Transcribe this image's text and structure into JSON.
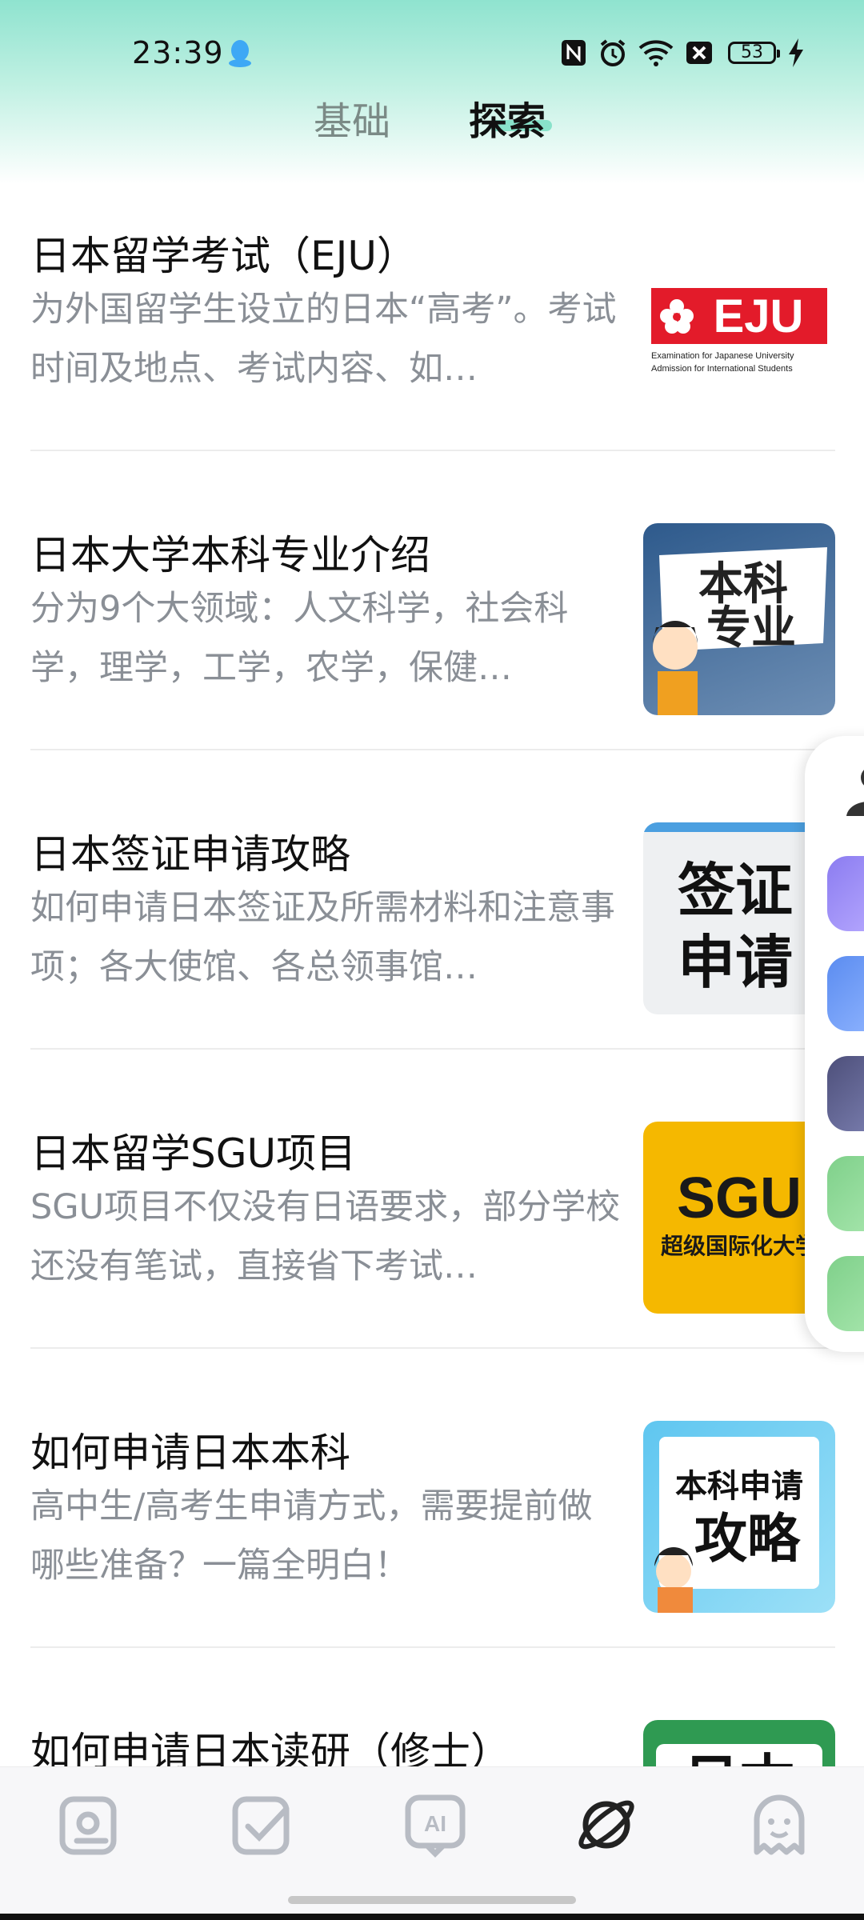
{
  "status_bar": {
    "time": "23:39",
    "battery": "53",
    "icons": [
      "qq-icon",
      "nfc-icon",
      "alarm-icon",
      "wifi-icon",
      "sim-off-icon",
      "battery-icon",
      "charging-icon"
    ]
  },
  "tabs": [
    {
      "label": "基础",
      "active": false
    },
    {
      "label": "探索",
      "active": true
    }
  ],
  "articles": [
    {
      "title": "日本留学考试（EJU）",
      "desc": "为外国留学生设立的日本“高考”。考试时间及地点、考试内容、如…",
      "thumb": {
        "main": "EJU",
        "line1": "Examination for Japanese University",
        "line2": "Admission for International Students"
      }
    },
    {
      "title": "日本大学本科专业介绍",
      "desc": "分为9个大领域：人文科学，社会科学，理学，工学，农学，保健…",
      "thumb": {
        "line1": "本科",
        "line2": "专业"
      }
    },
    {
      "title": "日本签证申请攻略",
      "desc": "如何申请日本签证及所需材料和注意事项；各大使馆、各总领事馆…",
      "thumb": {
        "line1": "签证",
        "line2": "申请"
      }
    },
    {
      "title": "日本留学SGU项目",
      "desc": "SGU项目不仅没有日语要求，部分学校还没有笔试，直接省下考试…",
      "thumb": {
        "main": "SGU",
        "sub": "超级国际化大学"
      }
    },
    {
      "title": "如何申请日本本科",
      "desc": "高中生/高考生申请方式，需要提前做哪些准备？一篇全明白！",
      "thumb": {
        "line1": "本科申请",
        "line2": "攻略"
      }
    },
    {
      "title": "如何申请日本读研（修士）",
      "desc": "",
      "thumb": {
        "line1": "日本"
      }
    }
  ],
  "bottom_nav": [
    {
      "icon": "photo-search-icon",
      "active": false
    },
    {
      "icon": "checkbox-icon",
      "active": false
    },
    {
      "icon": "ai-chat-icon",
      "label": "AI",
      "active": false
    },
    {
      "icon": "planet-icon",
      "active": true
    },
    {
      "icon": "ghost-profile-icon",
      "active": false
    }
  ],
  "colors": {
    "accent": "#7fe0c5",
    "muted_text": "#8a8f96",
    "nav_inactive": "#b8bcc4"
  }
}
